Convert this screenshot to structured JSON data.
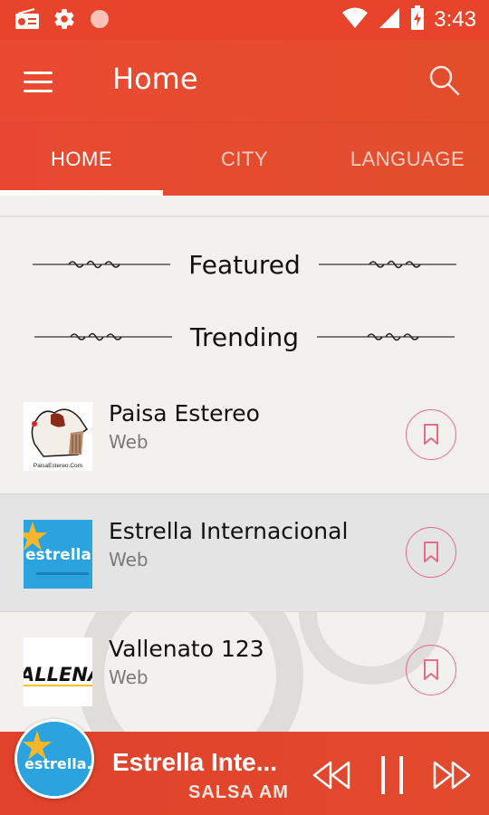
{
  "status_bar": {
    "time": "3:43",
    "left_icons": [
      "radio-icon",
      "gear-icon",
      "record-dot-icon"
    ],
    "right_icons": [
      "wifi-icon",
      "signal-icon",
      "battery-charging-icon"
    ]
  },
  "app_bar": {
    "title": "Home",
    "menu_icon": "hamburger-menu-icon",
    "search_icon": "search-icon"
  },
  "tabs": [
    {
      "label": "HOME",
      "active": true
    },
    {
      "label": "CITY",
      "active": false
    },
    {
      "label": "LANGUAGE",
      "active": false
    }
  ],
  "sections": {
    "featured": "Featured",
    "trending": "Trending"
  },
  "stations": [
    {
      "name": "Paisa Estereo",
      "type": "Web",
      "logo_text": "PaisaEstereo.Com",
      "selected": false
    },
    {
      "name": "Estrella Internacional",
      "type": "Web",
      "logo_text": "estrella.fm",
      "selected": true
    },
    {
      "name": "Vallenato 123",
      "type": "Web",
      "logo_text": "ALLENA",
      "selected": false
    }
  ],
  "player": {
    "title": "Estrella Inte...",
    "subtitle": "SALSA AM",
    "logo_text": "estrella.fm",
    "controls": [
      "rewind-icon",
      "pause-icon",
      "fast-forward-icon"
    ]
  },
  "colors": {
    "primary": "#e8442c",
    "bookmark_outline": "#e46b8c",
    "selected_row": "#e4e4e4",
    "background": "#f2f1ee"
  }
}
